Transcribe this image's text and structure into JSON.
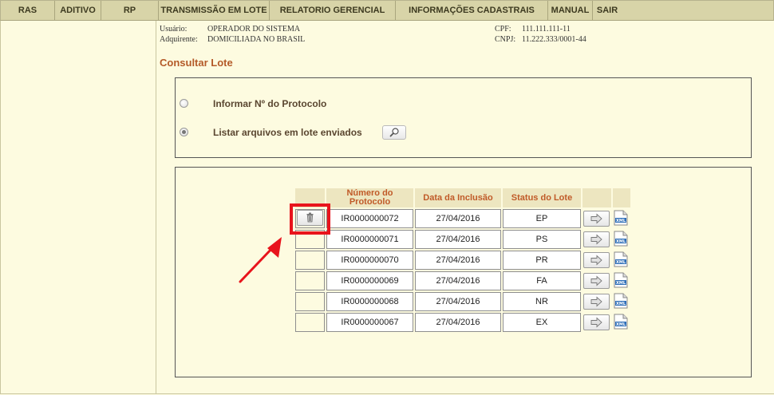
{
  "menu": {
    "items": [
      {
        "label": "RAS"
      },
      {
        "label": "ADITIVO"
      },
      {
        "label": "RP"
      },
      {
        "label": "TRANSMISSÃO EM LOTE"
      },
      {
        "label": "RELATORIO GERENCIAL"
      },
      {
        "label": "INFORMAÇÕES CADASTRAIS"
      },
      {
        "label": "MANUAL"
      },
      {
        "label": "SAIR"
      }
    ]
  },
  "user_info": {
    "usuario_label": "Usuário:",
    "usuario_value": "OPERADOR DO SISTEMA",
    "adquirente_label": "Adquirente:",
    "adquirente_value": "DOMICILIADA NO BRASIL",
    "cpf_label": "CPF:",
    "cpf_value": "111.111.111-11",
    "cnpj_label": "CNPJ:",
    "cnpj_value": "11.222.333/0001-44"
  },
  "page": {
    "title": "Consultar Lote"
  },
  "options": {
    "protocolo_label": "Informar Nº do Protocolo",
    "listar_label": "Listar arquivos em lote enviados",
    "selected": "listar"
  },
  "table": {
    "headers": {
      "numero": "Número do Protocolo",
      "data": "Data da Inclusão",
      "status": "Status do Lote"
    },
    "rows": [
      {
        "protocolo": "IR0000000072",
        "data": "27/04/2016",
        "status": "EP"
      },
      {
        "protocolo": "IR0000000071",
        "data": "27/04/2016",
        "status": "PS"
      },
      {
        "protocolo": "IR0000000070",
        "data": "27/04/2016",
        "status": "PR"
      },
      {
        "protocolo": "IR0000000069",
        "data": "27/04/2016",
        "status": "FA"
      },
      {
        "protocolo": "IR0000000068",
        "data": "27/04/2016",
        "status": "NR"
      },
      {
        "protocolo": "IR0000000067",
        "data": "27/04/2016",
        "status": "EX"
      }
    ],
    "icons": {
      "trash": "trash-icon",
      "arrow": "arrow-right-icon",
      "xml": "xml-file-icon",
      "search": "magnifier-icon"
    }
  },
  "annotation": {
    "highlight_color": "#e8141c"
  }
}
